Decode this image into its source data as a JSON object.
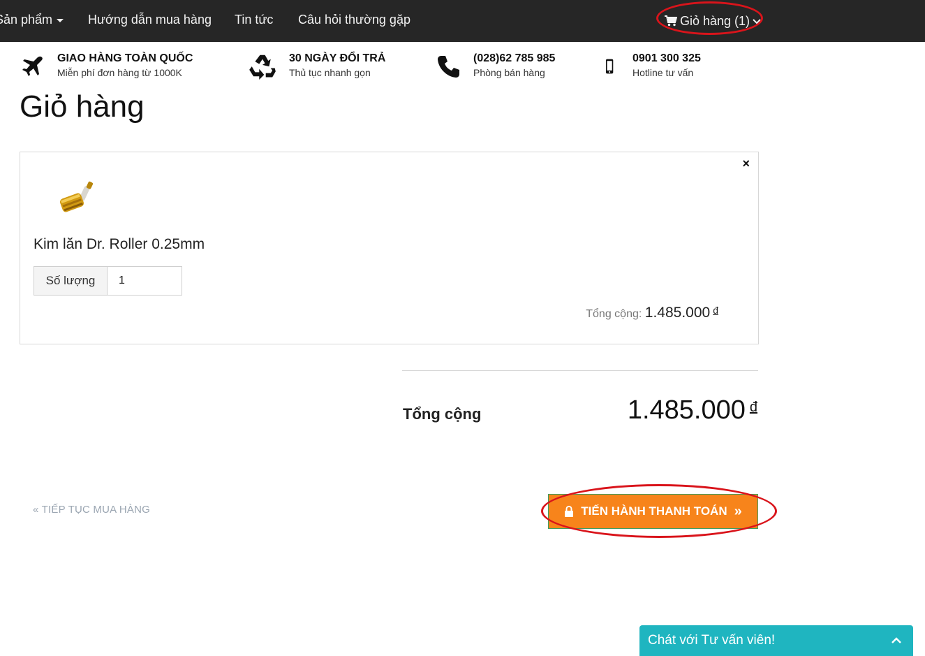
{
  "nav": {
    "items": [
      {
        "label": "Sản phẩm",
        "has_caret": true
      },
      {
        "label": "Hướng dẫn mua hàng"
      },
      {
        "label": "Tin tức"
      },
      {
        "label": "Câu hỏi thường gặp"
      }
    ],
    "cart_label": "Giỏ hàng (1)",
    "icons": {
      "cart": "cart-icon",
      "dropdown": "chevron-down-icon"
    }
  },
  "features": [
    {
      "icon": "airplane-icon",
      "title": "GIAO HÀNG TOÀN QUỐC",
      "subtitle": "Miễn phí đơn hàng từ 1000K"
    },
    {
      "icon": "recycle-icon",
      "title": "30 NGÀY ĐỔI TRẢ",
      "subtitle": "Thủ tục nhanh gọn"
    },
    {
      "icon": "phone-icon",
      "title": "(028)62 785 985",
      "subtitle": "Phòng bán hàng"
    },
    {
      "icon": "mobile-icon",
      "title": "0901 300 325",
      "subtitle": "Hotline tư vấn"
    }
  ],
  "page_title": "Giỏ hàng",
  "cart_item": {
    "name": "Kim lăn Dr. Roller 0.25mm",
    "quantity_label": "Số lượng",
    "quantity": "1",
    "total_label": "Tổng cộng:",
    "total_value": "1.485.000",
    "currency": "đ",
    "remove_symbol": "×"
  },
  "summary": {
    "label": "Tổng cộng",
    "value": "1.485.000",
    "currency": "đ"
  },
  "continue_label": "« TIẾP TỤC MUA HÀNG",
  "checkout_label": "TIẾN HÀNH THANH TOÁN",
  "checkout_arrow": "»",
  "chat": {
    "label": "Chát với Tư vấn viên!",
    "toggle": "^"
  },
  "colors": {
    "nav_bg": "#262626",
    "checkout_bg": "#f7841b",
    "chat_bg": "#1fb5c0",
    "highlight_ring": "#d9141b"
  }
}
